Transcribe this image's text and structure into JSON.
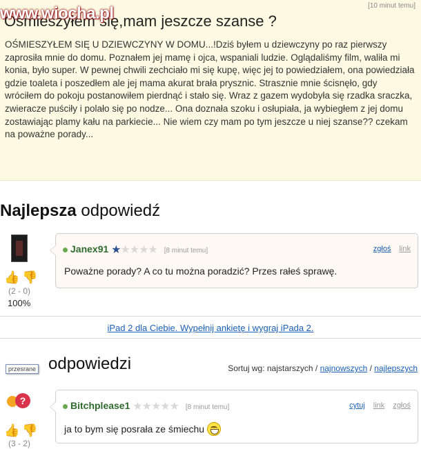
{
  "question": {
    "time": "[10 minut temu]",
    "title": "Ośmieszyłem się,mam jeszcze szanse ?",
    "body": "OŚMIESZYŁEM SIĘ U DZIEWCZYNY W DOMU...!Dziś byłem u dziewczyny po raz pierwszy zaprosiła mnie do domu. Poznałem jej mamę i ojca, wspaniali ludzie. Oglądaliśmy film, waliła mi konia, było super. W pewnej chwili zechciało mi się kupę, więc jej to powiedziałem, ona powiedziała gdzie toaleta i poszedłem ale jej mama akurat brała prysznic. Strasznie mnie ścisnęło, gdy wróciłem do pokoju postanowiłem pierdnąć i stało się. Wraz z gazem wydobyła się rzadka sraczka, zwieracze puściły i polało się po nodze... Ona doznała szoku i osłupiała, ja wybiegłem z jej domu zostawiając plamy kału na parkiecie... Nie wiem czy mam po tym jeszcze u niej szanse?? czekam na poważne porady..."
  },
  "watermark": "www.wiocha.pl",
  "best": {
    "heading_bold": "Najlepsza",
    "heading_rest": " odpowiedź",
    "user": "Janex91",
    "time": "[8 minut temu]",
    "link_report": "zgłoś",
    "link_link": "link",
    "text": "Poważne porady? A co tu można poradzić? Przes rałeś sprawę.",
    "votes": "(2 - 0)",
    "percent": "100%"
  },
  "ad": {
    "text": "iPad 2 dla Ciebie. Wypełnij ankietę i wygraj iPada 2."
  },
  "other": {
    "heading": "odpowiedzi",
    "tooltip": "przesrane",
    "sort_label": "Sortuj wg: najstarszych / ",
    "sort_newest": "najnowszych",
    "sort_sep": " / ",
    "sort_best": "najlepszych"
  },
  "answer2": {
    "user": "Bitchplease1",
    "time": "[8 minut temu]",
    "link_quote": "cytuj",
    "link_link": "link",
    "link_report": "zgłoś",
    "text": "ja to bym się posrała ze śmiechu",
    "votes": "(3 - 2)"
  },
  "colors": {
    "link": "#1a5fb4",
    "username": "#2e6a2e",
    "question_bg": "#fdfae3"
  },
  "icons": [
    "thumb-up-icon",
    "thumb-down-icon",
    "star-icon",
    "smiley-icon"
  ]
}
